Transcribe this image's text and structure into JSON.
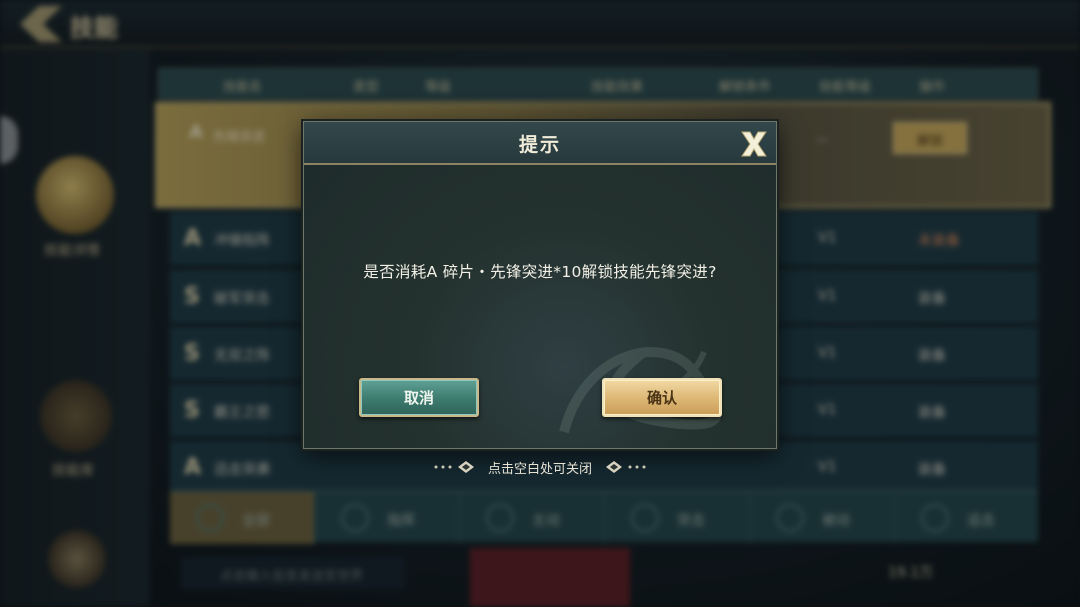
{
  "background": {
    "title": "技能",
    "sidebar": [
      {
        "label": "技能详情"
      },
      {
        "label": "技能库"
      },
      {
        "label": ""
      }
    ],
    "table_header": [
      "技能名",
      "类型",
      "等级",
      "技能效果",
      "解锁条件",
      "技能等级",
      "操作"
    ],
    "rows": [
      {
        "grade": "A",
        "name": "先锋突进",
        "level": "--",
        "state": "解锁"
      },
      {
        "grade": "A",
        "name": "冲锋陷阵",
        "level": "V1",
        "state": "未装备"
      },
      {
        "grade": "S",
        "name": "破军突击",
        "level": "V1",
        "state": "装备"
      },
      {
        "grade": "S",
        "name": "无双之阵",
        "level": "V1",
        "state": "装备"
      },
      {
        "grade": "S",
        "name": "霸王之怒",
        "level": "V1",
        "state": "装备"
      },
      {
        "grade": "A",
        "name": "迅击突袭",
        "level": "V1",
        "state": "装备"
      }
    ],
    "tabs": [
      "全部",
      "指挥",
      "主动",
      "突击",
      "被动",
      "追击"
    ],
    "chat_placeholder": "点击输入信息发送至世界",
    "currency": "19.1万"
  },
  "dialog": {
    "title": "提示",
    "message": "是否消耗A 碎片・先锋突进*10解锁技能先锋突进?",
    "cancel_label": "取消",
    "confirm_label": "确认",
    "hint": "点击空白处可关闭"
  },
  "colors": {
    "dialog_bg": "#24322f",
    "cancel_button": "#3d7a6f",
    "confirm_button": "#dcb673",
    "border_gold": "#c9b98a"
  }
}
